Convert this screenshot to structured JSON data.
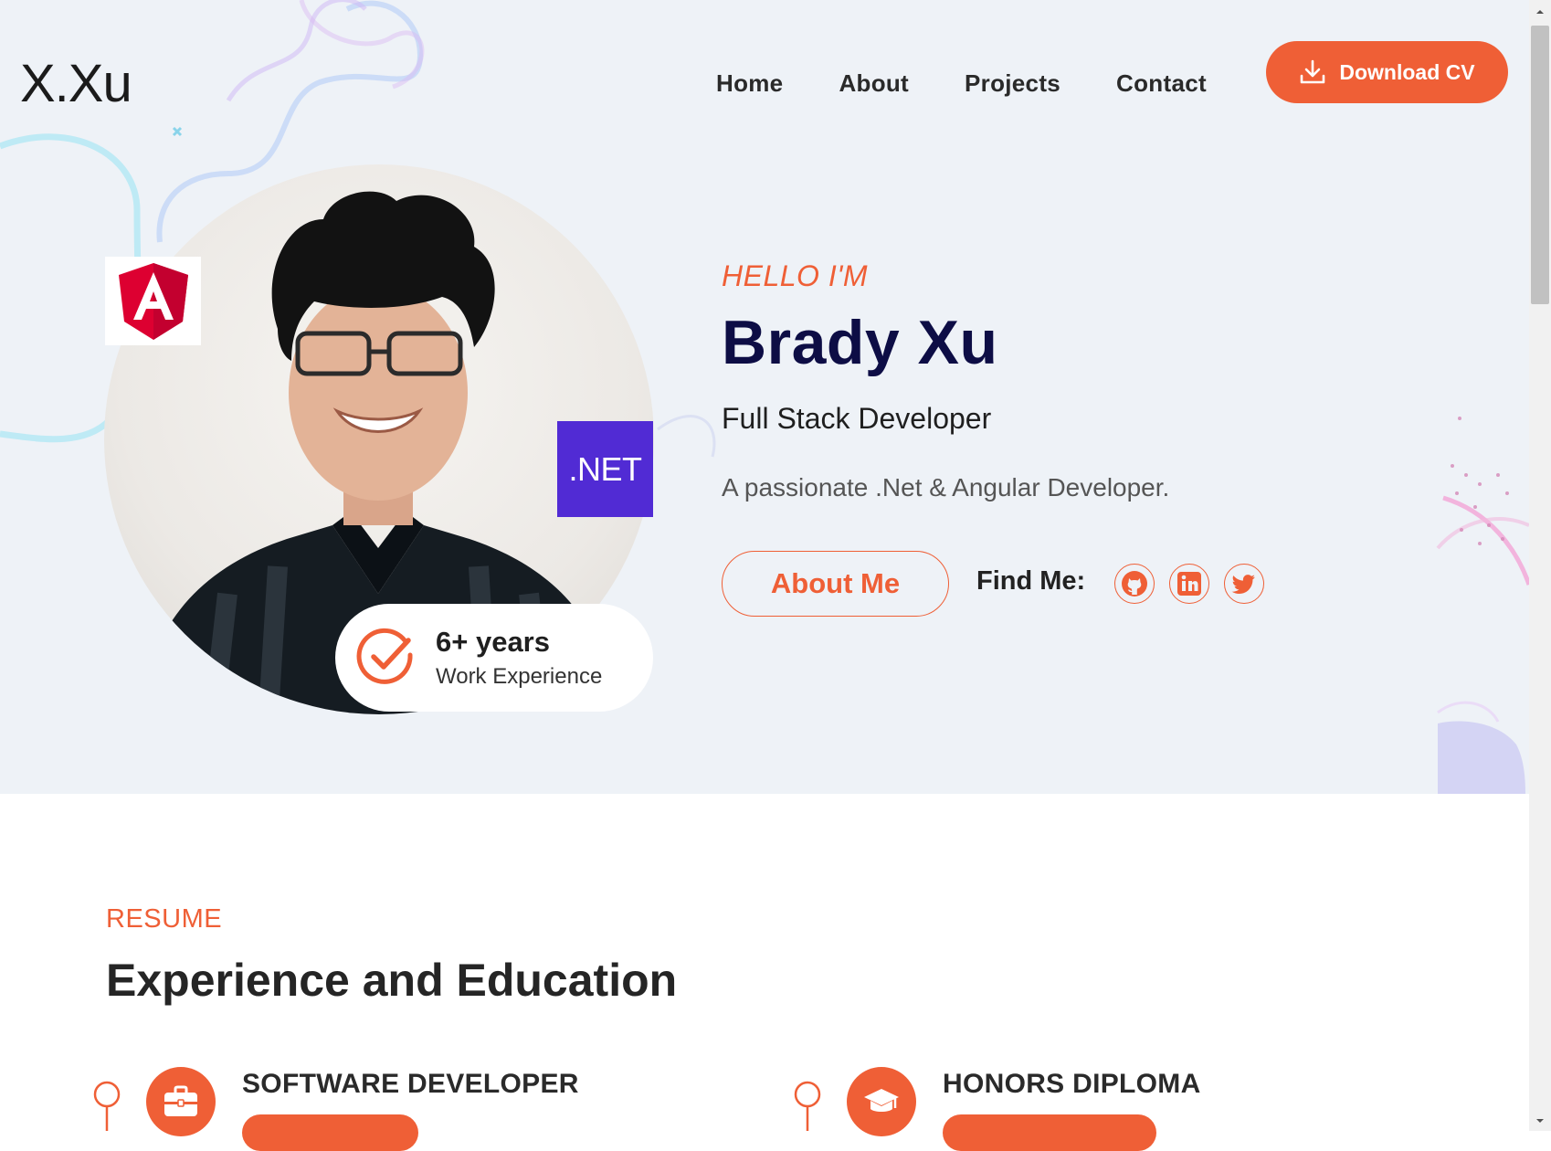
{
  "brand": {
    "logo": "X.Xu"
  },
  "nav": {
    "items": [
      "Home",
      "About",
      "Projects",
      "Contact"
    ]
  },
  "header": {
    "download_label": "Download CV"
  },
  "hero": {
    "angular_badge_icon": "angular-logo-icon",
    "dotnet_badge": ".NET",
    "experience": {
      "years": "6+ years",
      "label": "Work Experience",
      "icon": "check-circle-icon"
    },
    "greeting": "HELLO I'M",
    "name": "Brady Xu",
    "role": "Full Stack Developer",
    "tagline": "A passionate .Net & Angular Developer.",
    "about_button": "About Me",
    "find_me": "Find Me:",
    "social_icons": [
      "github-icon",
      "linkedin-icon",
      "twitter-icon"
    ]
  },
  "resume": {
    "label": "RESUME",
    "title": "Experience and Education",
    "columns": [
      {
        "title": "SOFTWARE DEVELOPER",
        "icon": "briefcase-icon"
      },
      {
        "title": "HONORS DIPLOMA",
        "icon": "graduation-cap-icon"
      }
    ]
  },
  "colors": {
    "accent": "#ef5f36",
    "name": "#0d0d45",
    "hero_bg": "#eef2f7",
    "dotnet": "#512bd4",
    "angular": "#dd0031"
  }
}
